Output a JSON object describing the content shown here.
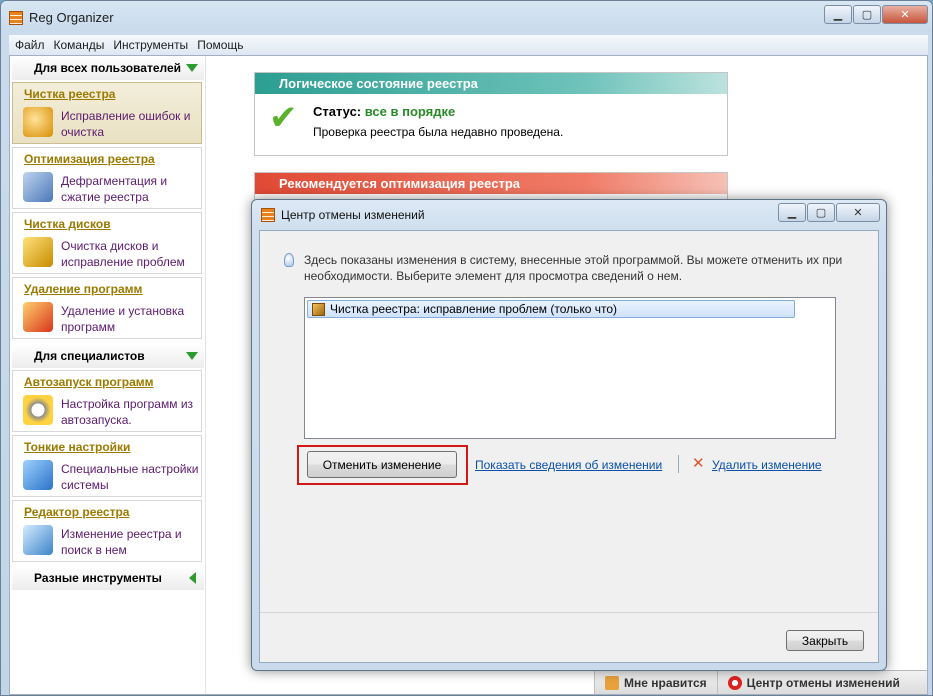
{
  "window": {
    "title": "Reg Organizer"
  },
  "menu": [
    "Файл",
    "Команды",
    "Инструменты",
    "Помощь"
  ],
  "sidebar": {
    "group_all": "Для всех пользователей",
    "group_pro": "Для специалистов",
    "group_misc": "Разные инструменты",
    "items": [
      {
        "title": "Чистка реестра",
        "desc": "Исправление ошибок и очистка"
      },
      {
        "title": "Оптимизация реестра",
        "desc": "Дефрагментация и сжатие реестра"
      },
      {
        "title": "Чистка дисков",
        "desc": "Очистка дисков и исправление проблем"
      },
      {
        "title": "Удаление программ",
        "desc": "Удаление и установка программ"
      },
      {
        "title": "Автозапуск программ",
        "desc": "Настройка программ из автозапуска."
      },
      {
        "title": "Тонкие настройки",
        "desc": "Специальные настройки системы"
      },
      {
        "title": "Редактор реестра",
        "desc": "Изменение реестра и поиск в нем"
      }
    ]
  },
  "panels": {
    "logical": {
      "header": "Логическое состояние реестра",
      "status_label": "Статус:",
      "status_value": "все в порядке",
      "subtext": "Проверка реестра была недавно проведена."
    },
    "optimize": {
      "header": "Рекомендуется оптимизация реестра"
    }
  },
  "statusbar": {
    "like": "Мне нравится",
    "undo_center": "Центр отмены изменений"
  },
  "dialog": {
    "title": "Центр отмены изменений",
    "info": "Здесь показаны изменения в систему, внесенные этой программой. Вы можете отменить их при необходимости. Выберите элемент для просмотра сведений о нем.",
    "list": [
      "Чистка реестра: исправление проблем (только что)"
    ],
    "undo_button": "Отменить изменение",
    "details_link": "Показать сведения об изменении",
    "delete_link": "Удалить изменение",
    "close_button": "Закрыть"
  },
  "colors": {
    "accent_green": "#2a8a2a",
    "link": "#0b4fa8",
    "highlight": "#d01818"
  }
}
